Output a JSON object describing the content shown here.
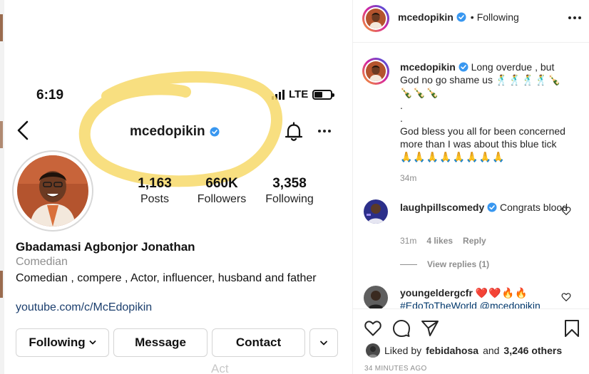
{
  "screenshot": {
    "status_time": "6:19",
    "network": "LTE",
    "username": "mcedopikin",
    "stats": [
      {
        "value": "1,163",
        "label": "Posts"
      },
      {
        "value": "660K",
        "label": "Followers"
      },
      {
        "value": "3,358",
        "label": "Following"
      }
    ],
    "full_name": "Gbadamasi Agbonjor Jonathan",
    "category": "Comedian",
    "bio": "Comedian , compere , Actor, influencer, husband and father",
    "link": "youtube.com/c/McEdopikin",
    "buttons": {
      "following": "Following",
      "message": "Message",
      "contact": "Contact"
    }
  },
  "post": {
    "header": {
      "username": "mcedopikin",
      "separator": "•",
      "follow_status": "Following"
    },
    "caption": {
      "username": "mcedopikin",
      "line1": "Long overdue , but God no go shame us",
      "line1_emoji": "🕺🕺🕺🕺🍾🍾🍾🍾",
      "dot1": ".",
      "dot2": ".",
      "line2": "God bless you all for been concerned more than I was about this blue tick",
      "line2_emoji": "🙏🙏🙏🙏🙏🙏🙏🙏",
      "time": "34m"
    },
    "comments": [
      {
        "username": "laughpillscomedy",
        "text": "Congrats blood",
        "time": "31m",
        "likes": "4 likes",
        "reply": "Reply",
        "view_replies": "View replies (1)"
      },
      {
        "username": "youngeldergcfr",
        "emoji": "❤️❤️🔥🔥",
        "tags": "#EdoToTheWorld @mcedopikin"
      }
    ],
    "liked_by": {
      "prefix": "Liked by",
      "user": "febidahosa",
      "connector": "and",
      "others": "3,246 others"
    },
    "time_ago": "34 MINUTES AGO",
    "watermark": "Act"
  },
  "colors": {
    "verified_blue": "#3897f0",
    "highlight": "#f7d96a",
    "link_blue": "#1c3f6e",
    "muted": "#8e8e8e",
    "heart_red": "#ed4956"
  },
  "icons": [
    "back-icon",
    "verified-icon",
    "bell-icon",
    "more-icon",
    "chevron-down-icon",
    "heart-icon",
    "comment-icon",
    "share-icon",
    "bookmark-icon"
  ]
}
